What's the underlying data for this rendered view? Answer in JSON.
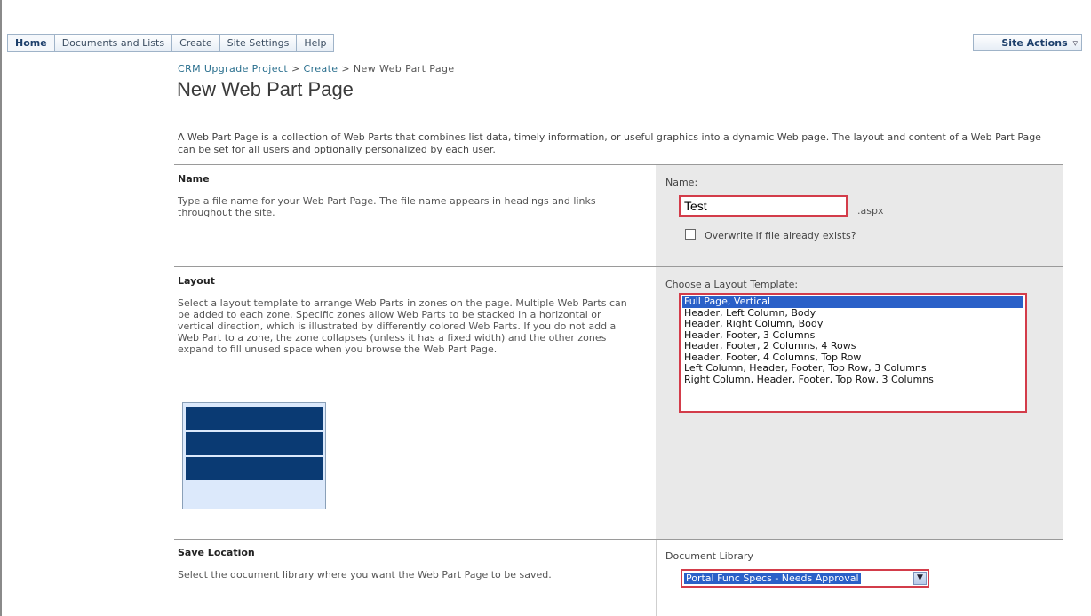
{
  "nav": {
    "tabs": [
      {
        "label": "Home",
        "active": true
      },
      {
        "label": "Documents and Lists"
      },
      {
        "label": "Create"
      },
      {
        "label": "Site Settings"
      },
      {
        "label": "Help"
      }
    ],
    "site_actions": "Site Actions",
    "site_actions_icon": "chevron-down-icon"
  },
  "breadcrumb": {
    "items": [
      "CRM Upgrade Project",
      "Create",
      "New Web Part Page"
    ],
    "separator": ">"
  },
  "page_title": "New Web Part Page",
  "intro": "A Web Part Page is a collection of Web Parts that combines list data, timely information, or useful graphics into a dynamic Web page. The layout and content of a Web Part Page can be set for all users and optionally personalized by each user.",
  "sections": {
    "name": {
      "title": "Name",
      "description": "Type a file name for your Web Part Page.  The file name appears in headings and links throughout the site.",
      "field_label": "Name:",
      "value": "Test",
      "extension": ".aspx",
      "overwrite_label": "Overwrite if file already exists?",
      "overwrite_checked": false
    },
    "layout": {
      "title": "Layout",
      "description": "Select a layout template to arrange Web Parts in zones on the page. Multiple Web Parts can be added to each zone. Specific zones allow Web Parts to be stacked in a horizontal or vertical direction, which is illustrated by differently colored Web Parts. If you do not add a Web Part to a zone, the zone collapses (unless it has a fixed width) and the other zones expand to fill unused space when you browse the Web Part Page.",
      "field_label": "Choose a Layout Template:",
      "options": [
        "Full Page, Vertical",
        "Header, Left Column, Body",
        "Header, Right Column, Body",
        "Header, Footer, 3 Columns",
        "Header, Footer, 2 Columns, 4 Rows",
        "Header, Footer, 4 Columns, Top Row",
        "Left Column, Header, Footer, Top Row, 3 Columns",
        "Right Column, Header, Footer, Top Row, 3 Columns"
      ],
      "selected": "Full Page, Vertical"
    },
    "save_location": {
      "title": "Save Location",
      "description": "Select the document library where you want the Web Part Page to be saved.",
      "field_label": "Document Library",
      "selected": "Portal Func Specs - Needs Approval"
    }
  },
  "colors": {
    "selection": "#2a60c8",
    "highlight_border": "#d33c4a",
    "zone": "#0a3a73",
    "link": "#2a6f8e"
  }
}
